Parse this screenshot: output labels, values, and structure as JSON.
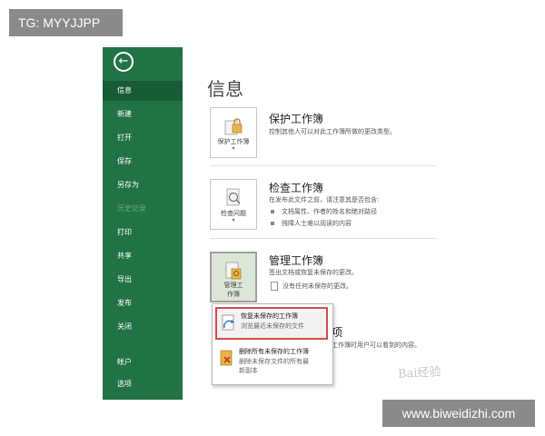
{
  "overlay": {
    "top_tag": "TG: MYYJJPP",
    "bottom_tag": "www.biweidizhi.com"
  },
  "sidebar": {
    "back_glyph": "←",
    "items": [
      {
        "label": "信息",
        "state": "active"
      },
      {
        "label": "新建"
      },
      {
        "label": "打开"
      },
      {
        "label": "保存"
      },
      {
        "label": "另存为"
      },
      {
        "label": "历史记录",
        "state": "disabled"
      },
      {
        "label": "打印"
      },
      {
        "label": "共享"
      },
      {
        "label": "导出"
      },
      {
        "label": "发布"
      },
      {
        "label": "关闭"
      },
      {
        "label": "帐户"
      },
      {
        "label": "选项"
      }
    ]
  },
  "main": {
    "title": "信息",
    "protect": {
      "tile_label": "保护工作簿",
      "title": "保护工作簿",
      "desc": "控制其他人可以对此工作簿所做的更改类型。"
    },
    "inspect": {
      "tile_label": "检查问题",
      "title": "检查工作簿",
      "desc": "在发布此文件之前，请注意其是否包含:",
      "bullets": [
        "文档属性、作者的姓名和绝对路径",
        "残障人士难以阅读的内容"
      ]
    },
    "manage": {
      "tile_label_1": "管理工",
      "tile_label_2": "作簿",
      "title": "管理工作簿",
      "desc": "签出文档或恢复未保存的更改。",
      "note": "没有任何未保存的更改。"
    },
    "browser_view": {
      "title_fragment": "选项",
      "desc_fragment": "工作簿时用户可以看到的内容。"
    },
    "dropdown": [
      {
        "title": "恢复未保存的工作簿",
        "desc": "浏览最近未保存的文件"
      },
      {
        "title": "删除所有未保存的工作簿",
        "desc": "删除未保存文件的所有最",
        "desc2": "新副本"
      }
    ],
    "watermark": "Bai经验"
  },
  "colors": {
    "sidebar_bg": "#217346",
    "sidebar_active": "#185c37",
    "highlight_border": "#d24b4b",
    "tag_bg": "#8a8a8a"
  },
  "icons": {
    "back": "back-arrow-icon",
    "protect": "lock-icon",
    "inspect": "inspect-document-icon",
    "manage": "manage-workbook-icon",
    "recover": "recover-file-icon",
    "delete": "delete-file-icon"
  }
}
